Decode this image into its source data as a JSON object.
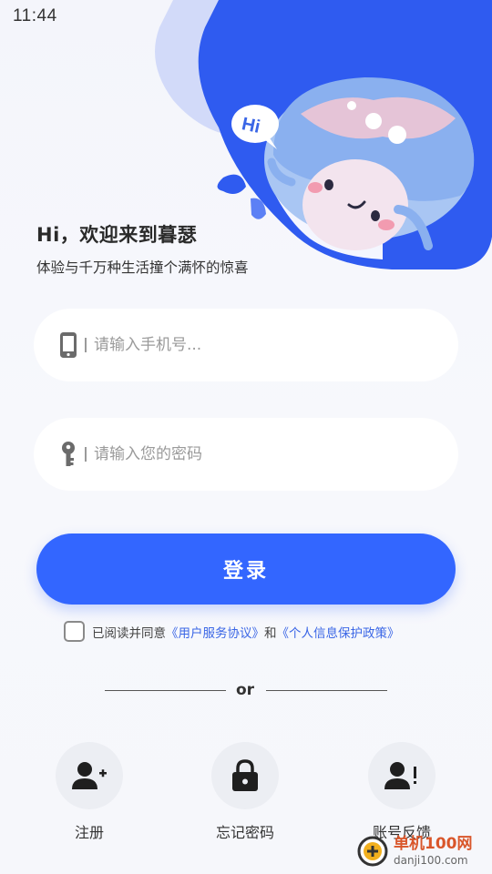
{
  "status_bar": {
    "time": "11:44"
  },
  "hero": {
    "bubble_text": "Hi"
  },
  "welcome": {
    "title": "Hi，欢迎来到暮瑟",
    "subtitle": "体验与千万种生活撞个满怀的惊喜"
  },
  "form": {
    "phone_placeholder": "请输入手机号...",
    "password_placeholder": "请输入您的密码",
    "login_label": "登录"
  },
  "agreement": {
    "prefix": "已阅读并同意",
    "terms_link": "《用户服务协议》",
    "conjunction": "和",
    "privacy_link": "《个人信息保护政策》",
    "checked": false
  },
  "divider": {
    "text": "or"
  },
  "actions": [
    {
      "label": "注册",
      "icon": "add-user-icon"
    },
    {
      "label": "忘记密码",
      "icon": "lock-icon"
    },
    {
      "label": "账号反馈",
      "icon": "user-alert-icon"
    }
  ],
  "watermark": {
    "name": "单机100网",
    "domain": "danji100.com"
  },
  "colors": {
    "primary": "#3366ff",
    "link": "#3a66e6",
    "hero_blue": "#2f5bf0",
    "background": "#f5f6fb"
  }
}
